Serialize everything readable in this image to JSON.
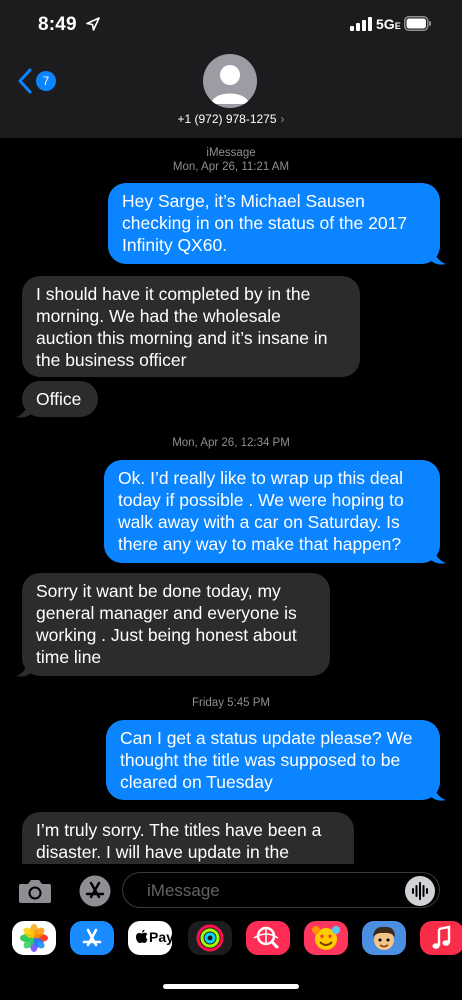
{
  "status_bar": {
    "time": "8:49",
    "network": "5G",
    "network_suffix": "E"
  },
  "header": {
    "back_badge": "7",
    "contact": "+1 (972) 978-1275",
    "chevron": "›"
  },
  "stamps": [
    {
      "service": "iMessage",
      "datetime": "Mon, Apr 26, 11:21 AM"
    },
    {
      "datetime": "Mon, Apr 26, 12:34 PM"
    },
    {
      "datetime": "Friday 5:45 PM"
    }
  ],
  "messages": [
    {
      "direction": "out",
      "lines": [
        "Hey Sarge, it’s Michael Sausen",
        "checking in on the status of the 2017",
        "Infinity QX60."
      ]
    },
    {
      "direction": "in",
      "lines": [
        "I should have it completed by in the",
        "morning. We had the wholesale",
        "auction this morning and it’s insane in",
        "the business officer"
      ]
    },
    {
      "direction": "in",
      "lines": [
        "Office"
      ]
    },
    {
      "direction": "out",
      "lines": [
        "Ok.  I’d really like to wrap up this deal",
        "today if possible .  We were hoping to",
        "walk away with a car on Saturday.  Is",
        "there any way to make that happen?"
      ]
    },
    {
      "direction": "in",
      "lines": [
        "Sorry it want be done today, my",
        "general manager and everyone is",
        "working . Just being honest about",
        "time line"
      ]
    },
    {
      "direction": "out",
      "lines": [
        "Can I get a status update please? We",
        "thought the title was supposed to be",
        "cleared on Tuesday"
      ]
    },
    {
      "direction": "in",
      "lines": [
        "I’m truly sorry. The titles have been a",
        "disaster. I will have update in the"
      ]
    }
  ],
  "compose": {
    "placeholder": "iMessage"
  },
  "drawer": {
    "apps": [
      {
        "name": "Photos",
        "icon": "photos-icon",
        "color": "#ffffff"
      },
      {
        "name": "App Store",
        "icon": "app-store-icon",
        "color": "#1b8cff"
      },
      {
        "name": "Apple Pay",
        "icon": "apple-pay-icon",
        "color": "#ffffff",
        "label": "Pay"
      },
      {
        "name": "Activity",
        "icon": "activity-icon",
        "color": "#1c1c1e"
      },
      {
        "name": "Images Search",
        "icon": "images-search-icon",
        "color": "#ff2d55"
      },
      {
        "name": "Animoji",
        "icon": "animoji-icon",
        "color": "#ff375f"
      },
      {
        "name": "Memoji",
        "icon": "memoji-icon",
        "color": "#4a8fe2"
      },
      {
        "name": "Music",
        "icon": "music-icon",
        "color": "#fa2d48"
      }
    ]
  },
  "colors": {
    "outgoing": "#0a84ff",
    "incoming": "#2c2c2e",
    "background": "#000000",
    "chrome": "#1c1c1e"
  }
}
